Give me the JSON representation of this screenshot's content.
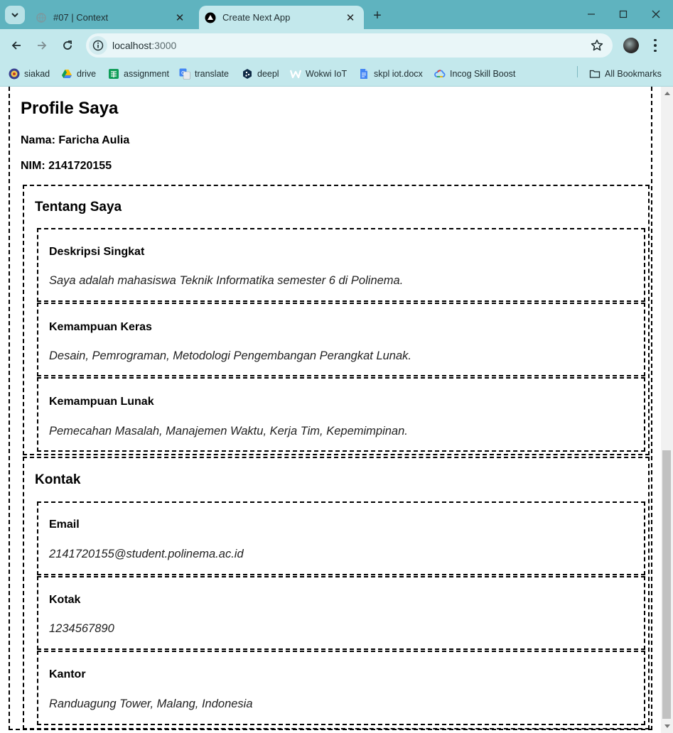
{
  "browser": {
    "tabs": [
      {
        "title": "#07 | Context",
        "active": false
      },
      {
        "title": "Create Next App",
        "active": true
      }
    ],
    "address": {
      "host": "localhost",
      "port": ":3000"
    },
    "bookmarks": [
      {
        "label": "siakad",
        "icon": "university-seal-icon"
      },
      {
        "label": "drive",
        "icon": "google-drive-icon"
      },
      {
        "label": "assignment",
        "icon": "google-sheets-icon"
      },
      {
        "label": "translate",
        "icon": "google-translate-icon"
      },
      {
        "label": "deepl",
        "icon": "deepl-icon"
      },
      {
        "label": "Wokwi IoT",
        "icon": "wokwi-icon"
      },
      {
        "label": "skpl iot.docx",
        "icon": "document-icon"
      },
      {
        "label": "Incog Skill Boost",
        "icon": "google-cloud-icon"
      }
    ],
    "all_bookmarks_label": "All Bookmarks"
  },
  "page": {
    "title": "Profile Saya",
    "nama": "Nama: Faricha Aulia",
    "nim": "NIM: 2141720155",
    "about": {
      "heading": "Tentang Saya",
      "cards": [
        {
          "label": "Deskripsi Singkat",
          "value": "Saya adalah mahasiswa Teknik Informatika semester 6 di Polinema."
        },
        {
          "label": "Kemampuan Keras",
          "value": "Desain, Pemrograman, Metodologi Pengembangan Perangkat Lunak."
        },
        {
          "label": "Kemampuan Lunak",
          "value": "Pemecahan Masalah, Manajemen Waktu, Kerja Tim, Kepemimpinan."
        }
      ]
    },
    "contact": {
      "heading": "Kontak",
      "cards": [
        {
          "label": "Email",
          "value": "2141720155@student.polinema.ac.id"
        },
        {
          "label": "Kotak",
          "value": "1234567890"
        },
        {
          "label": "Kantor",
          "value": "Randuagung Tower, Malang, Indonesia"
        }
      ]
    }
  },
  "colors": {
    "tabstrip": "#5fb3bf",
    "toolbar": "#c3e8ec",
    "omnibox": "#e9f6f8",
    "border": "#000000"
  }
}
